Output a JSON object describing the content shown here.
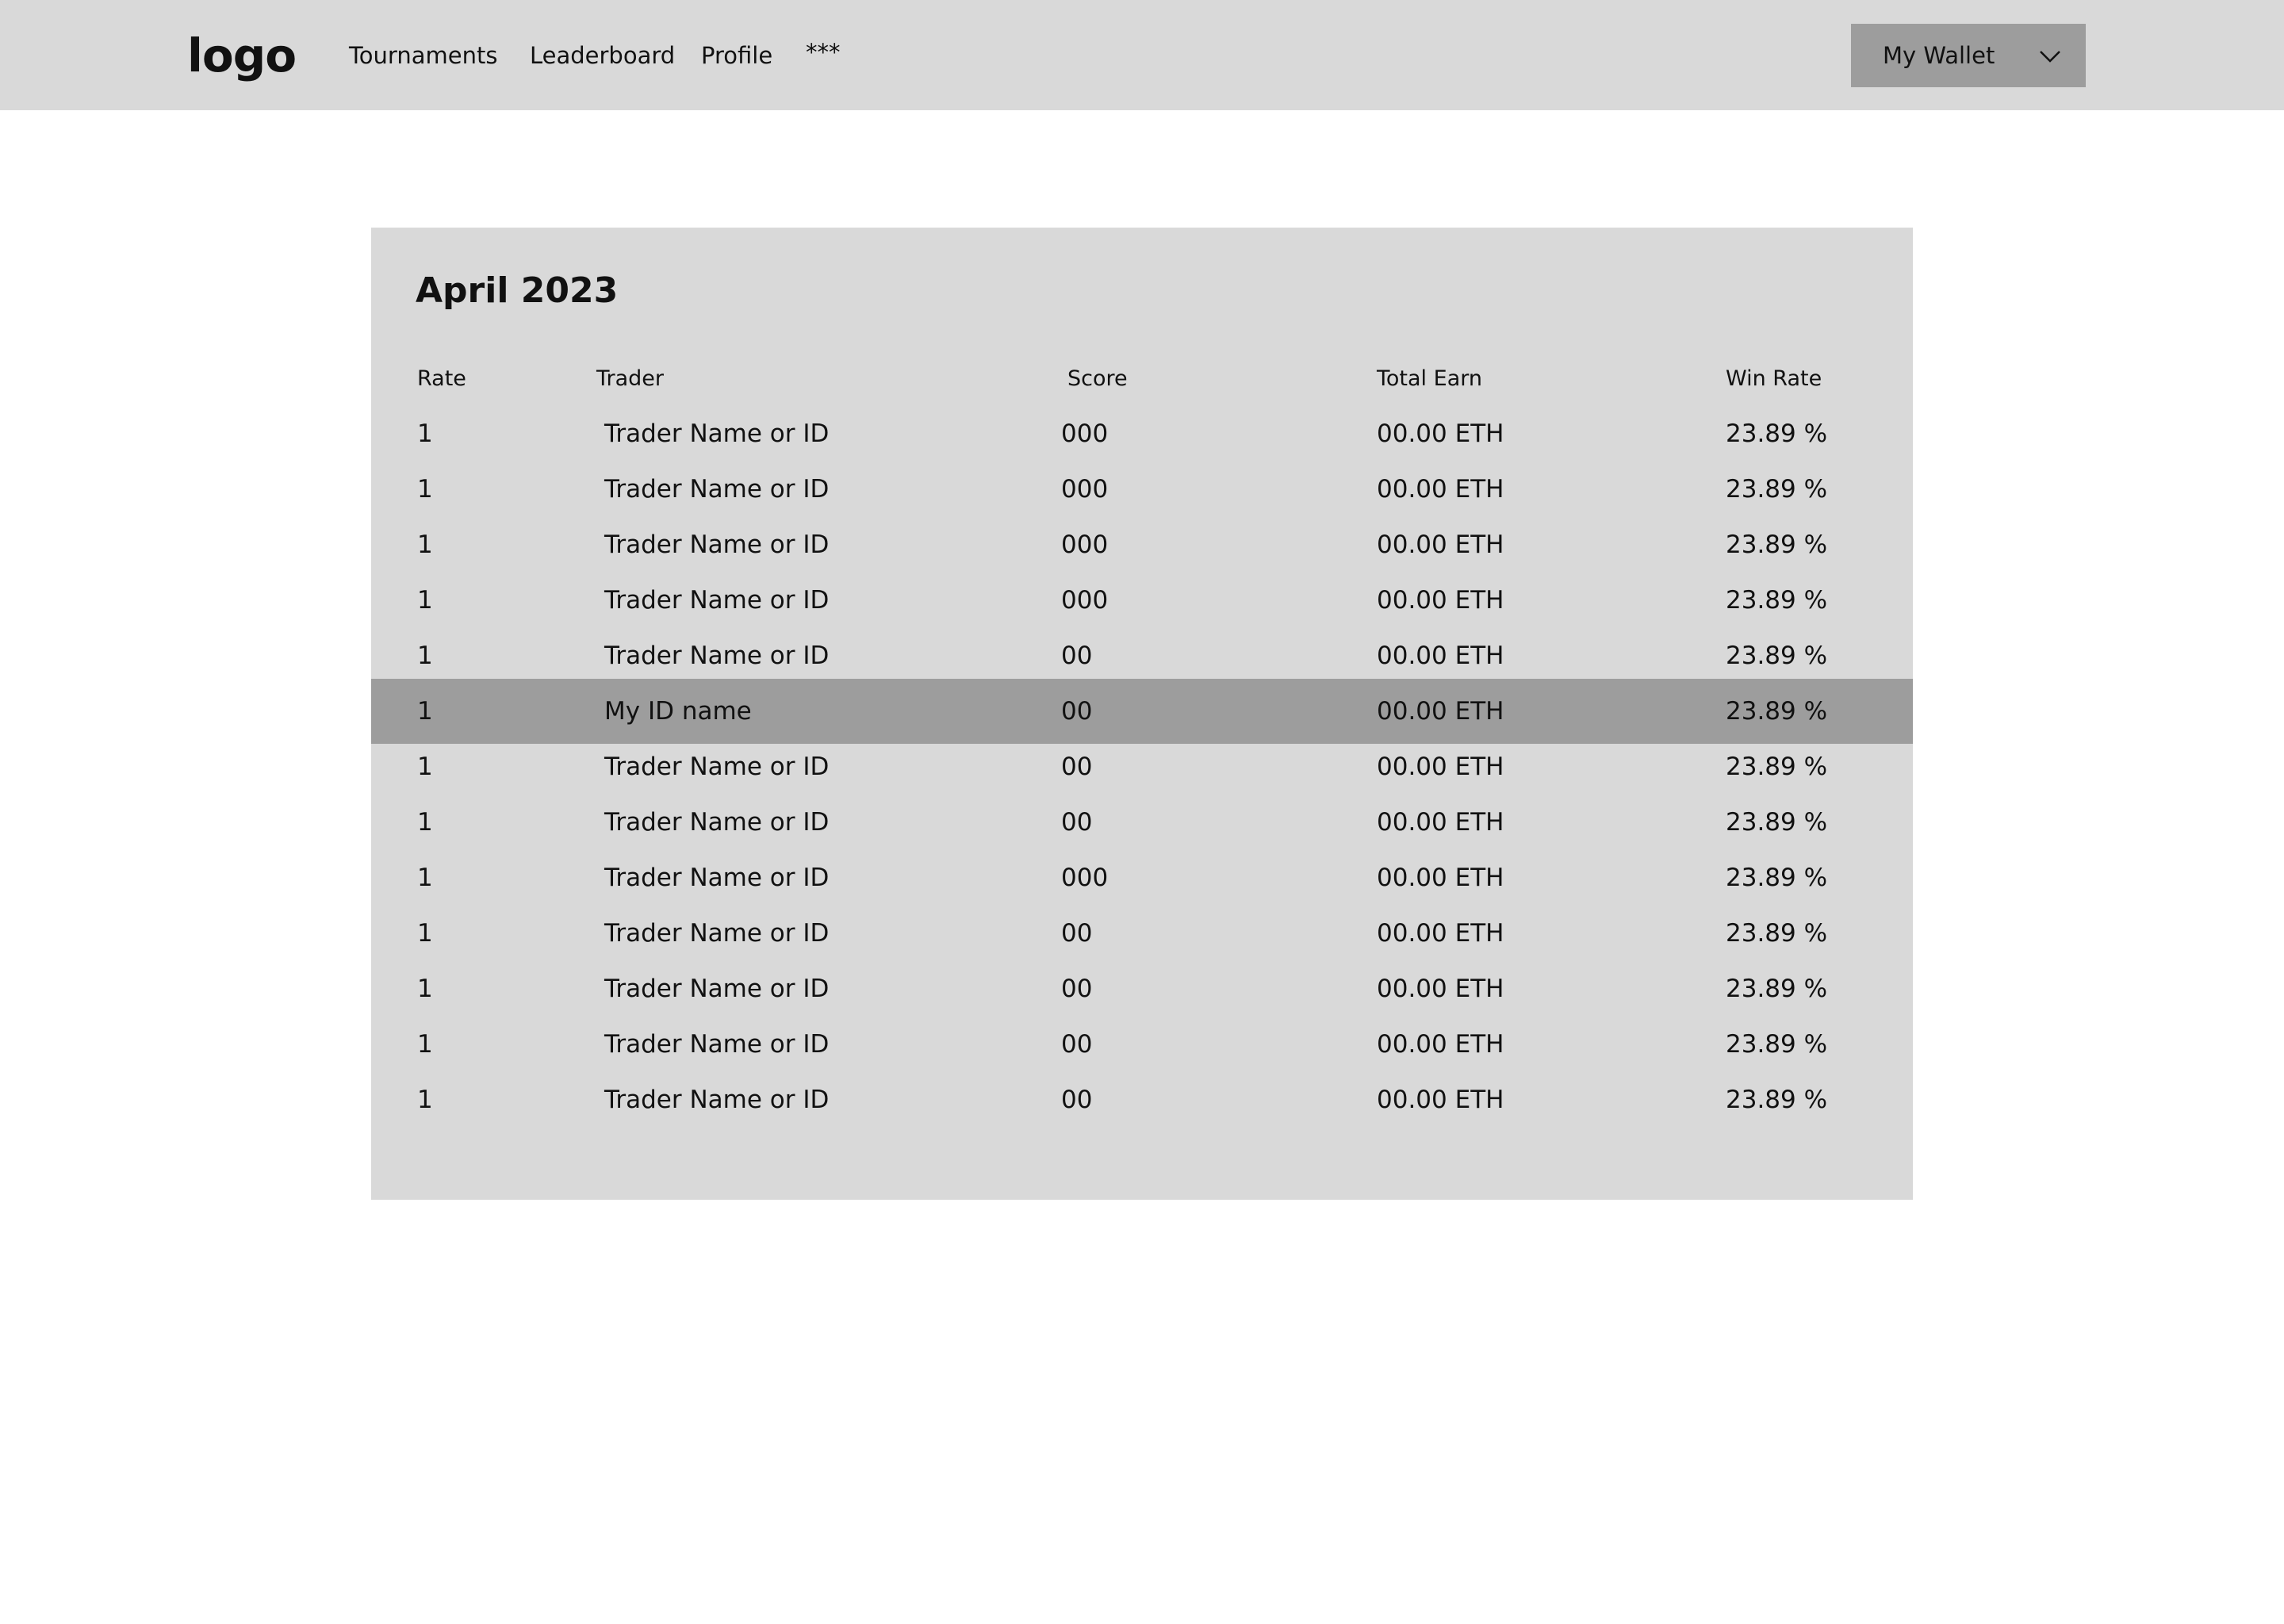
{
  "header": {
    "logo": "logo",
    "nav": [
      {
        "label": "Tournaments"
      },
      {
        "label": "Leaderboard"
      },
      {
        "label": "Profile"
      },
      {
        "label": "***"
      }
    ],
    "wallet": {
      "label": "My Wallet",
      "icon": "chevron-down-icon"
    }
  },
  "leaderboard": {
    "title": "April 2023",
    "columns": [
      "Rate",
      "Trader",
      "Score",
      "Total Earn",
      "Win Rate"
    ],
    "rows": [
      {
        "rate": "1",
        "trader": "Trader Name or ID",
        "score": "000",
        "earn": "00.00 ETH",
        "win": "23.89 %"
      },
      {
        "rate": "1",
        "trader": "Trader Name or ID",
        "score": "000",
        "earn": "00.00 ETH",
        "win": "23.89 %"
      },
      {
        "rate": "1",
        "trader": "Trader Name or ID",
        "score": "000",
        "earn": "00.00 ETH",
        "win": "23.89 %"
      },
      {
        "rate": "1",
        "trader": "Trader Name or ID",
        "score": "000",
        "earn": "00.00 ETH",
        "win": "23.89 %"
      },
      {
        "rate": "1",
        "trader": "Trader Name or ID",
        "score": "00",
        "earn": "00.00 ETH",
        "win": "23.89 %"
      },
      {
        "rate": "1",
        "trader": "My ID name",
        "score": "00",
        "earn": "00.00 ETH",
        "win": "23.89 %",
        "highlighted": true
      },
      {
        "rate": "1",
        "trader": "Trader Name or ID",
        "score": "00",
        "earn": "00.00 ETH",
        "win": "23.89 %"
      },
      {
        "rate": "1",
        "trader": "Trader Name or ID",
        "score": "00",
        "earn": "00.00 ETH",
        "win": "23.89 %"
      },
      {
        "rate": "1",
        "trader": "Trader Name or ID",
        "score": "000",
        "earn": "00.00 ETH",
        "win": "23.89 %"
      },
      {
        "rate": "1",
        "trader": "Trader Name or ID",
        "score": "00",
        "earn": "00.00 ETH",
        "win": "23.89 %"
      },
      {
        "rate": "1",
        "trader": "Trader Name or ID",
        "score": "00",
        "earn": "00.00 ETH",
        "win": "23.89 %"
      },
      {
        "rate": "1",
        "trader": "Trader Name or ID",
        "score": "00",
        "earn": "00.00 ETH",
        "win": "23.89 %"
      },
      {
        "rate": "1",
        "trader": "Trader Name or ID",
        "score": "00",
        "earn": "00.00 ETH",
        "win": "23.89 %"
      }
    ]
  }
}
